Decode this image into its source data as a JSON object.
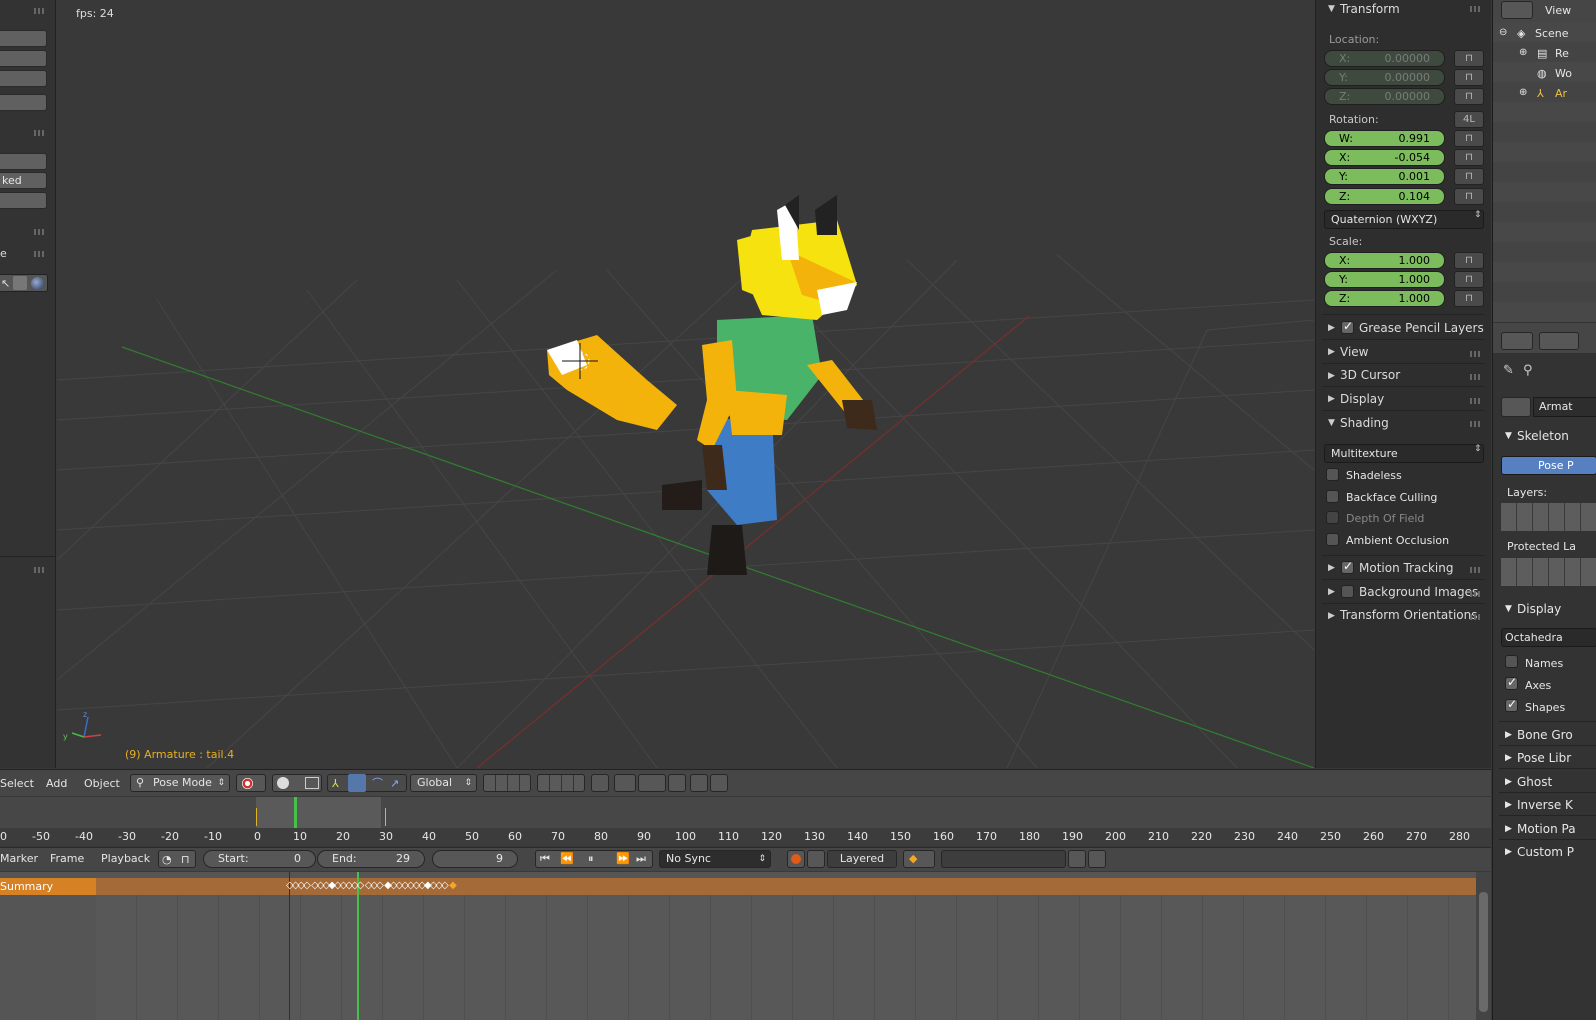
{
  "viewport": {
    "fps": "fps: 24",
    "object_info": "(9) Armature : tail.4"
  },
  "left_shelf": {
    "buttons": [
      "",
      "",
      "",
      "",
      "",
      "ked",
      ""
    ],
    "label": "e"
  },
  "transform": {
    "title": "Transform",
    "location_label": "Location:",
    "location": [
      {
        "k": "X:",
        "v": "0.00000"
      },
      {
        "k": "Y:",
        "v": "0.00000"
      },
      {
        "k": "Z:",
        "v": "0.00000"
      }
    ],
    "rotation_label": "Rotation:",
    "rotation_mode_btn": "4L",
    "rotation": [
      {
        "k": "W:",
        "v": "0.991"
      },
      {
        "k": "X:",
        "v": "-0.054"
      },
      {
        "k": "Y:",
        "v": "0.001"
      },
      {
        "k": "Z:",
        "v": "0.104"
      }
    ],
    "rotation_mode": "Quaternion (WXYZ)",
    "scale_label": "Scale:",
    "scale": [
      {
        "k": "X:",
        "v": "1.000"
      },
      {
        "k": "Y:",
        "v": "1.000"
      },
      {
        "k": "Z:",
        "v": "1.000"
      }
    ]
  },
  "npanel_sections": {
    "grease_pencil": "Grease Pencil Layers",
    "view": "View",
    "cursor": "3D Cursor",
    "display": "Display",
    "shading": "Shading",
    "shading_mode": "Multitexture",
    "shadeless": "Shadeless",
    "backface": "Backface Culling",
    "dof": "Depth Of Field",
    "ao": "Ambient Occlusion",
    "motion_tracking": "Motion Tracking",
    "background_images": "Background Images",
    "transform_orientations": "Transform Orientations"
  },
  "header3d": {
    "select": "Select",
    "add": "Add",
    "object": "Object",
    "mode": "Pose Mode",
    "orientation": "Global"
  },
  "timeline": {
    "ticks": [
      "0",
      "-50",
      "-40",
      "-30",
      "-20",
      "-10",
      "0",
      "10",
      "20",
      "30",
      "40",
      "50",
      "60",
      "70",
      "80",
      "90",
      "100",
      "110",
      "120",
      "130",
      "140",
      "150",
      "160",
      "170",
      "180",
      "190",
      "200",
      "210",
      "220",
      "230",
      "240",
      "250",
      "260",
      "270",
      "280"
    ],
    "marker": "Marker",
    "frame": "Frame",
    "playback": "Playback",
    "start_label": "Start:",
    "start": "0",
    "end_label": "End:",
    "end": "29",
    "current": "9",
    "sync": "No Sync",
    "keying": "Layered"
  },
  "dopesheet": {
    "summary": "Summary"
  },
  "outliner": {
    "view": "View",
    "items": [
      "Scene",
      "Re",
      "Wo",
      "Ar"
    ]
  },
  "properties": {
    "object_name": "Armat",
    "skeleton": "Skeleton",
    "pose_btn": "Pose P",
    "layers": "Layers:",
    "protected": "Protected La",
    "display": "Display",
    "display_mode": "Octahedra",
    "names": "Names",
    "axes": "Axes",
    "shapes": "Shapes",
    "bone_groups": "Bone Gro",
    "pose_library": "Pose Libr",
    "ghost": "Ghost",
    "inverse_k": "Inverse K",
    "motion_paths": "Motion Pa",
    "custom": "Custom P"
  },
  "colors": {
    "accent_green": "#7cbc5d",
    "summary_orange": "#d78125",
    "keyframe": "#f5a623",
    "playhead": "#47c047"
  }
}
